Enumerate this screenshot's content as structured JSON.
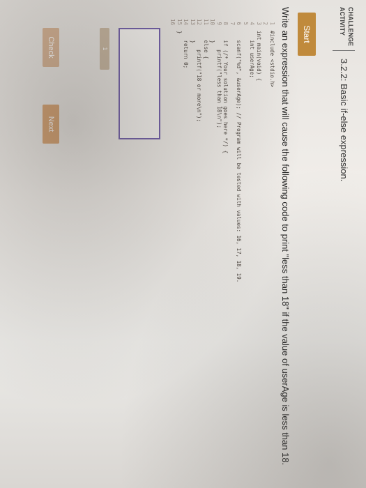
{
  "header": {
    "badge_line1": "CHALLENGE",
    "badge_line2": "ACTIVITY",
    "title": "3.2.2: Basic if-else expression."
  },
  "start_label": "Start",
  "instruction": "Write an expression that will cause the following code to print \"less than 18\" if the value of userAge is less than 18.",
  "code": [
    {
      "n": "1",
      "text": "#include <stdio.h>"
    },
    {
      "n": "2",
      "text": ""
    },
    {
      "n": "3",
      "text": "int main(void) {"
    },
    {
      "n": "4",
      "text": "   int userAge;"
    },
    {
      "n": "5",
      "text": ""
    },
    {
      "n": "6",
      "text": "   scanf(\"%d\", &userAge); // Program will be tested with values: 16, 17, 18, 19."
    },
    {
      "n": "7",
      "text": ""
    },
    {
      "n": "8",
      "text": "   if (/* Your solution goes here */) {"
    },
    {
      "n": "9",
      "text": "      printf(\"less than 18\\n\");"
    },
    {
      "n": "10",
      "text": "   }"
    },
    {
      "n": "11",
      "text": "   else {"
    },
    {
      "n": "12",
      "text": "      printf(\"18 or more\\n\");"
    },
    {
      "n": "13",
      "text": "   }"
    },
    {
      "n": "14",
      "text": "   return 0;"
    },
    {
      "n": "15",
      "text": "}"
    },
    {
      "n": "16",
      "text": ""
    }
  ],
  "progress": {
    "active_step": "1"
  },
  "buttons": {
    "check": "Check",
    "next": "Next"
  }
}
